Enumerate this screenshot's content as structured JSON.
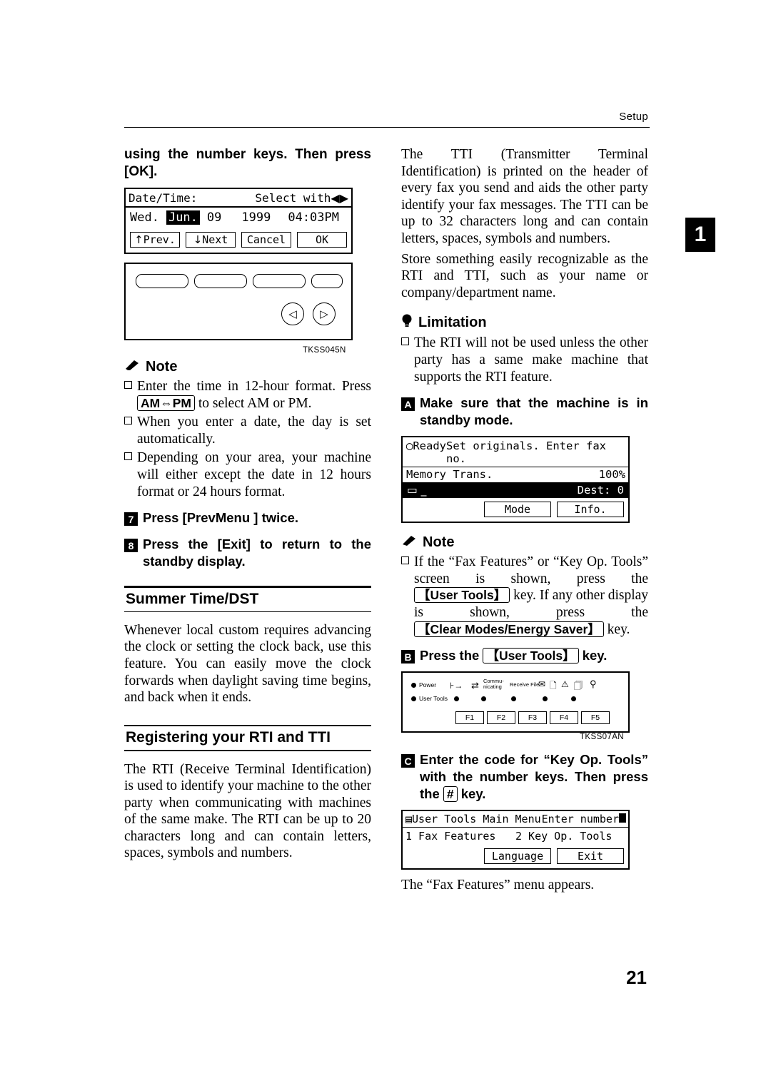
{
  "running_head": "Setup",
  "chapter_tab": "1",
  "page_number": "21",
  "left": {
    "lead_bold": "using the number keys. Then press [OK].",
    "figure_datetime": {
      "title": "Date/Time:",
      "select_with": "Select with",
      "day": "Wed.",
      "month": "Jun.",
      "date": "09",
      "year": "1999",
      "time": "04:03PM",
      "btn_prev": "Prev.",
      "btn_next": "Next",
      "btn_cancel": "Cancel",
      "btn_ok": "OK",
      "figure_code": "TKSS045N"
    },
    "note_label": "Note",
    "notes": [
      "Enter the time in 12-hour format. Press [AM⇔PM] to select AM or PM.",
      "When you enter a date, the day is set automatically.",
      "Depending on your area, your machine will either except the date in 12 hours format or 24 hours format."
    ],
    "note_1_pre": "Enter the time in 12-hour format. Press",
    "note_1_key": "AM⇔PM",
    "note_1_post": "to select AM or PM.",
    "steps": [
      {
        "num": "7",
        "pre": "Press",
        "key": "PrevMenu",
        "post": "twice."
      },
      {
        "num": "8",
        "pre": "Press the",
        "key": "Exit",
        "post": "to return to the standby display."
      }
    ],
    "section_summer": {
      "heading": "Summer Time/DST",
      "body": "Whenever local custom requires advancing the clock or setting the clock back, use this feature. You can easily move the clock forwards when daylight saving time begins, and back when it ends."
    },
    "section_rti": {
      "heading": "Registering your RTI and TTI",
      "body": "The RTI (Receive Terminal Identification) is used to identify your machine to the other party when communicating with machines of the same make. The RTI can be up to 20 characters long and can contain letters, spaces, symbols and numbers."
    }
  },
  "right": {
    "para1": "The TTI (Transmitter Terminal Identification) is printed on the header of every fax you send and aids the other party identify your fax messages. The TTI can be up to 32 characters long and can contain letters, spaces, symbols and numbers.",
    "para2": "Store something easily recognizable as the RTI and TTI, such as your name or company/department name.",
    "limitation_label": "Limitation",
    "limitation_item": "The RTI will not be used unless the other party has a same make machine that supports the RTI feature.",
    "step_a": {
      "num": "A",
      "text": "Make sure that the machine is in standby mode."
    },
    "figure_ready": {
      "ready": "Ready",
      "prompt": "Set originals. Enter fax no.",
      "memory": "Memory Trans.",
      "percent": "100%",
      "dest_label": "Dest:",
      "dest_value": "0",
      "btn_mode": "Mode",
      "btn_info": "Info."
    },
    "note_label": "Note",
    "note_item_parts": {
      "p1": "If the “Fax Features” or “Key Op. Tools” screen is shown, press the",
      "k1": "User Tools",
      "p2": "key. If any other display is shown, press the",
      "k2": "Clear Modes/Energy Saver",
      "p3": "key."
    },
    "step_b": {
      "num": "B",
      "pre": "Press the",
      "key": "User Tools",
      "post": "key."
    },
    "figure_keypanel": {
      "power": "Power",
      "user_tools": "User Tools",
      "communicating": "Commu-nicating",
      "receive_file": "Receive File",
      "f_keys": [
        "F1",
        "F2",
        "F3",
        "F4",
        "F5"
      ],
      "figure_code": "TKSS07AN"
    },
    "step_c": {
      "num": "C",
      "pre": "Enter the code for “Key Op. Tools” with the number keys. Then press the",
      "key": "#",
      "post": "key."
    },
    "figure_menu": {
      "title": "User Tools Main Menu",
      "enter_number": "Enter number",
      "item1": "1 Fax Features",
      "item2": "2 Key Op. Tools",
      "btn_language": "Language",
      "btn_exit": "Exit"
    },
    "closing": "The “Fax Features” menu appears."
  }
}
